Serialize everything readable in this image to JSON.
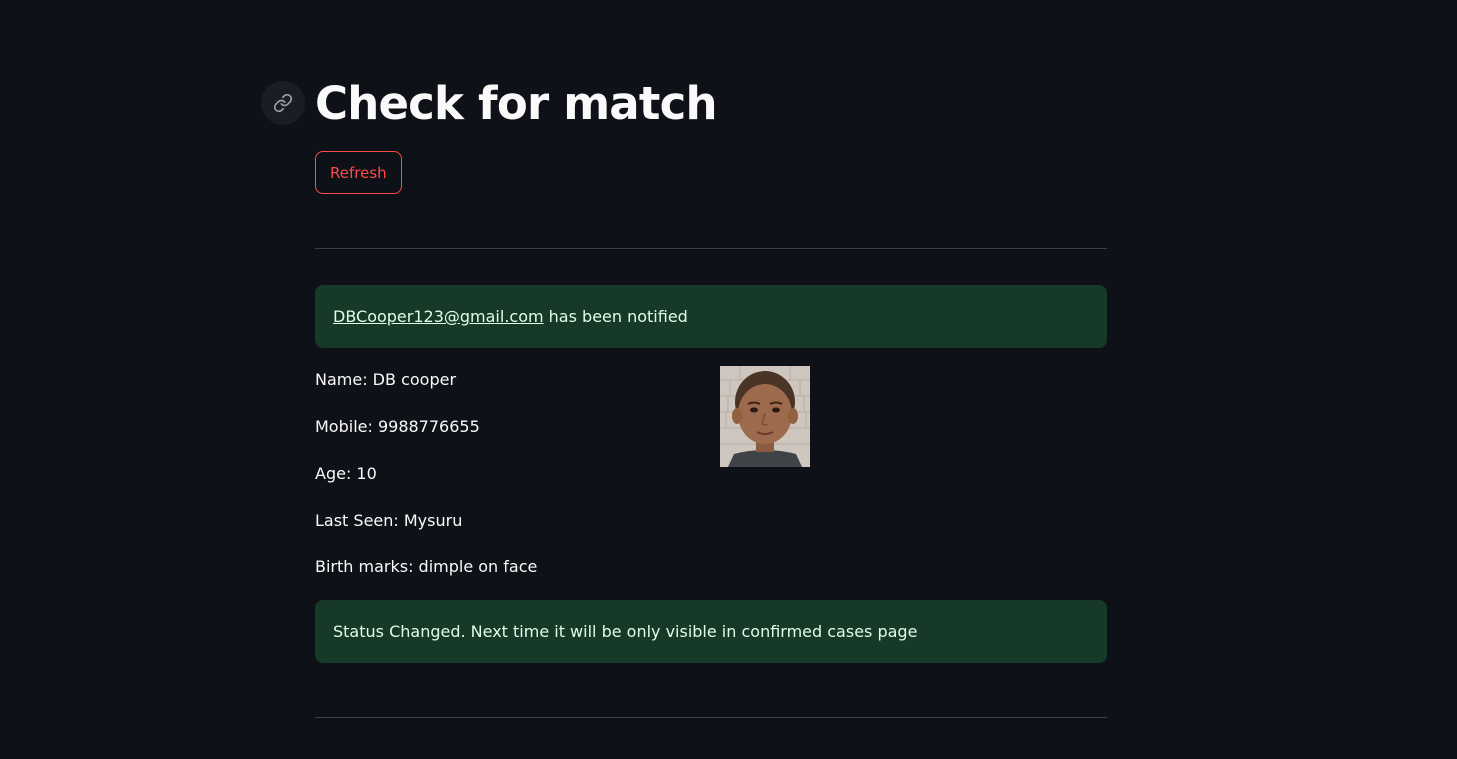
{
  "header": {
    "title": "Check for match",
    "refresh_label": "Refresh"
  },
  "notification": {
    "email": "DBCooper123@gmail.com",
    "message": " has been notified"
  },
  "person": {
    "name": "Name: DB cooper",
    "mobile": "Mobile: 9988776655",
    "age": "Age: 10",
    "last_seen": "Last Seen: Mysuru",
    "birth_marks": "Birth marks: dimple on face"
  },
  "status": {
    "message": "Status Changed. Next time it will be only visible in confirmed cases page"
  },
  "colors": {
    "background": "#0e1117",
    "accent": "#ff4b4b",
    "success_bg": "#173928",
    "success_text": "#dffde9"
  },
  "icons": {
    "anchor": "link-icon"
  }
}
